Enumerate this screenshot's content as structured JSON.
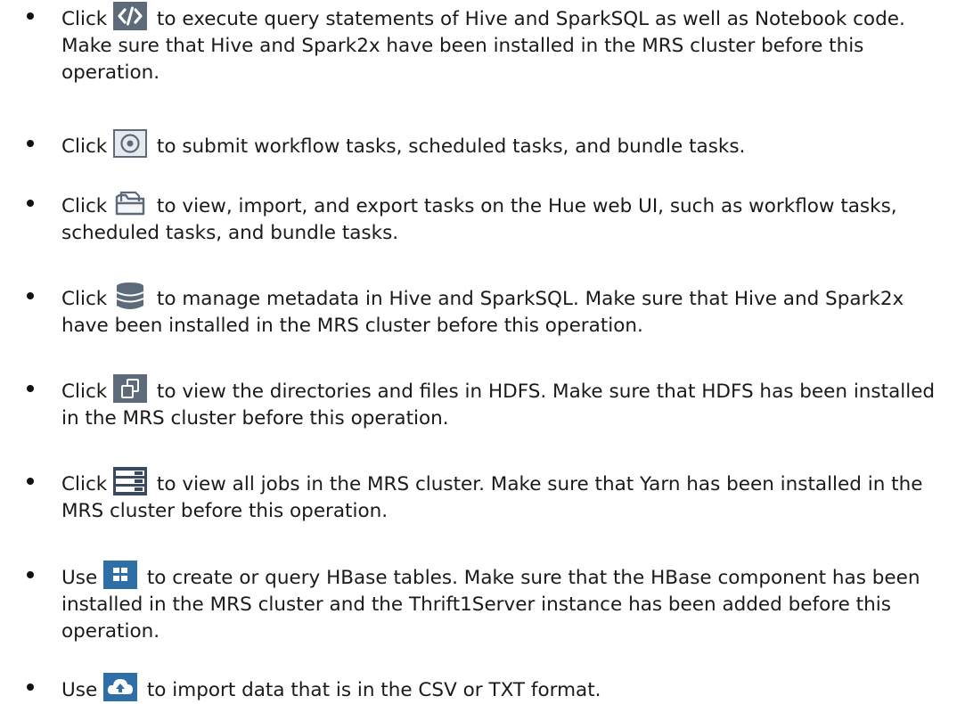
{
  "items": [
    {
      "verb": "Click",
      "icon": "code-editor-icon",
      "text": "to execute query statements of Hive and SparkSQL as well as Notebook code. Make sure that Hive and Spark2x have been installed in the MRS cluster before this operation."
    },
    {
      "verb": "Click",
      "icon": "scheduler-icon",
      "text": "to submit workflow tasks, scheduled tasks, and bundle tasks."
    },
    {
      "verb": "Click",
      "icon": "folder-icon",
      "text": "to view, import, and export tasks on the Hue web UI, such as workflow tasks, scheduled tasks, and bundle tasks."
    },
    {
      "verb": "Click",
      "icon": "database-icon",
      "text": "to manage metadata in Hive and SparkSQL. Make sure that Hive and Spark2x have been installed in the MRS cluster before this operation."
    },
    {
      "verb": "Click",
      "icon": "files-icon",
      "text": "to view the directories and files in HDFS. Make sure that HDFS has been installed in the MRS cluster before this operation."
    },
    {
      "verb": "Click",
      "icon": "jobs-icon",
      "text": "to view all jobs in the MRS cluster. Make sure that Yarn has been installed in the MRS cluster before this operation."
    },
    {
      "verb": "Use",
      "icon": "hbase-grid-icon",
      "text": "to create or query HBase tables. Make sure that the HBase component has been installed in the MRS cluster and the Thrift1Server instance has been added before this operation."
    },
    {
      "verb": "Use",
      "icon": "cloud-upload-icon",
      "text": "to import data that is in the CSV or TXT format."
    }
  ]
}
